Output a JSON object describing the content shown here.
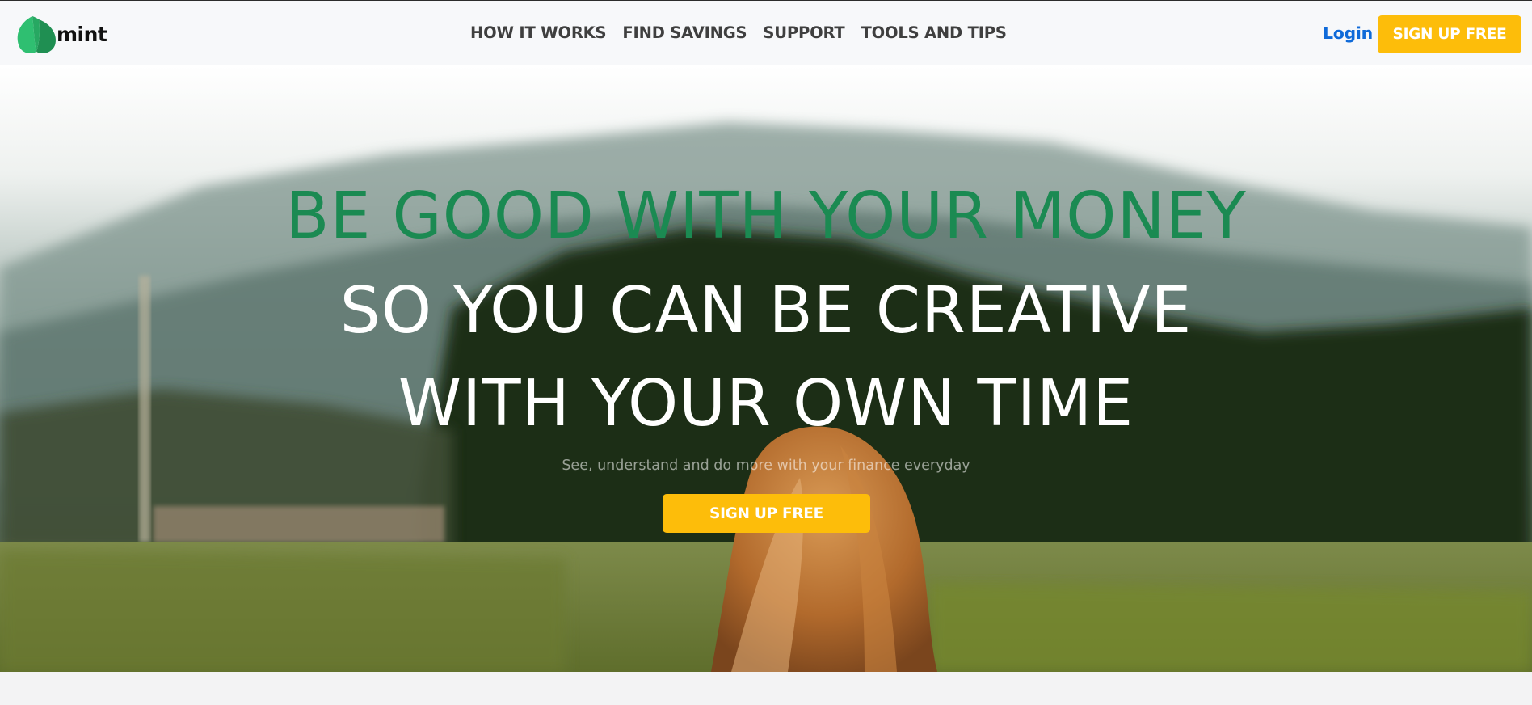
{
  "brand": {
    "name": "mint",
    "logo_icon": "mint-leaf-icon"
  },
  "nav": {
    "items": [
      {
        "label": "HOW IT WORKS"
      },
      {
        "label": "FIND SAVINGS"
      },
      {
        "label": "SUPPORT"
      },
      {
        "label": "TOOLS AND TIPS"
      }
    ],
    "login_label": "Login",
    "signup_label": "SIGN UP FREE"
  },
  "hero": {
    "line1": "BE GOOD WITH YOUR MONEY",
    "line2": "SO YOU CAN BE CREATIVE",
    "line3": "WITH YOUR OWN TIME",
    "subtitle": "See, understand and do more with your finance everyday",
    "cta_label": "SIGN UP FREE"
  },
  "colors": {
    "brand_green": "#1b8a52",
    "cta_yellow": "#fdbd0a",
    "link_blue": "#0f6ad9",
    "header_bg": "#f7f8fa"
  }
}
